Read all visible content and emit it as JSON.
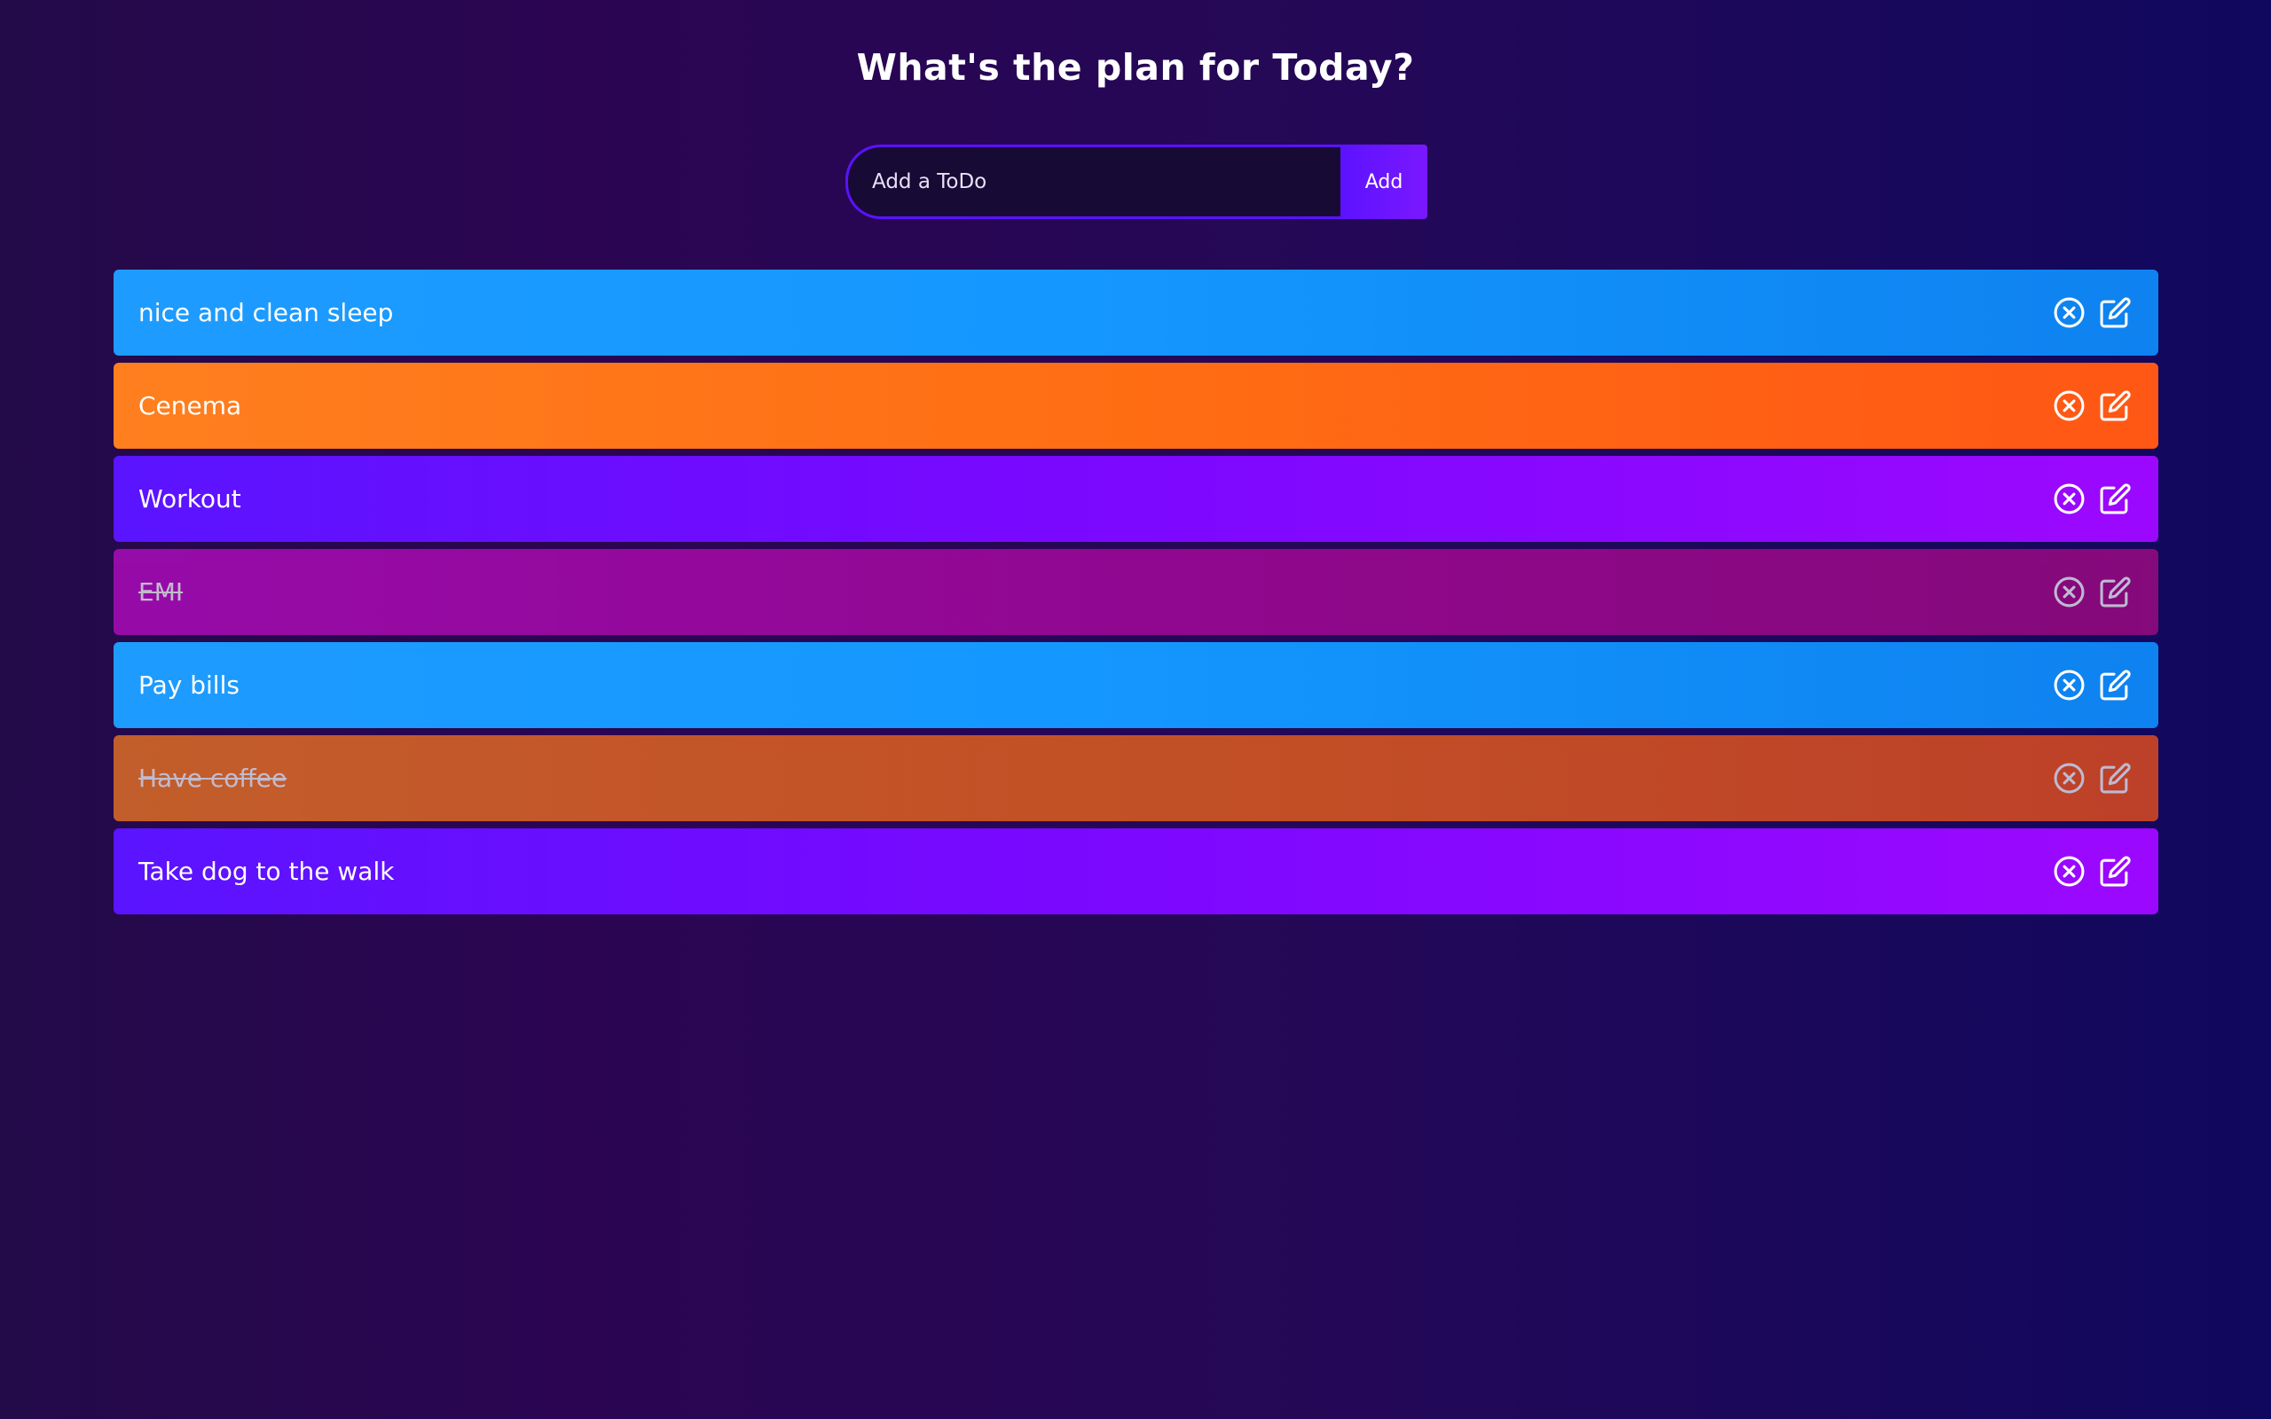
{
  "header": {
    "title": "What's the plan for Today?"
  },
  "form": {
    "placeholder": "Add a ToDo",
    "value": "",
    "add_label": "Add"
  },
  "todos": [
    {
      "text": "nice and clean sleep",
      "color": "blue",
      "complete": false
    },
    {
      "text": "Cenema",
      "color": "orange",
      "complete": false
    },
    {
      "text": "Workout",
      "color": "purple",
      "complete": false
    },
    {
      "text": "EMI",
      "color": "magenta",
      "complete": true
    },
    {
      "text": "Pay bills",
      "color": "blue",
      "complete": false
    },
    {
      "text": "Have coffee",
      "color": "orange",
      "complete": true
    },
    {
      "text": "Take dog to the walk",
      "color": "purple",
      "complete": false
    }
  ],
  "icons": {
    "delete": "close-circle-icon",
    "edit": "edit-icon"
  },
  "colors": {
    "accent": "#5c12ff",
    "background": "#230a49"
  }
}
